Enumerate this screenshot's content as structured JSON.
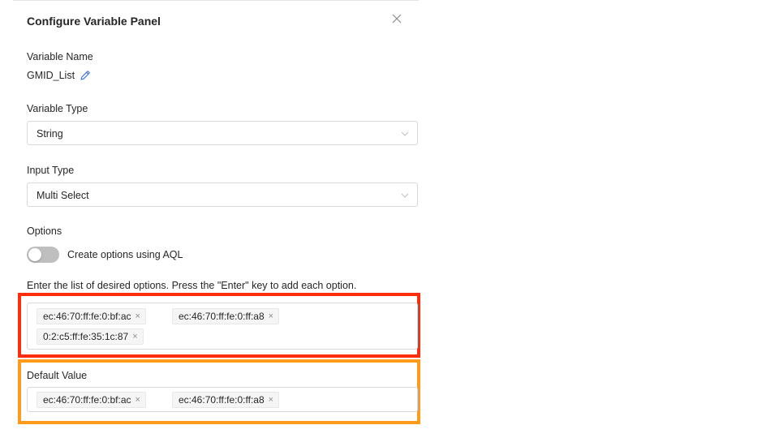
{
  "panel": {
    "title": "Configure Variable Panel",
    "close_icon": "close-icon"
  },
  "variable_name": {
    "label": "Variable Name",
    "value": "GMID_List",
    "edit_icon": "pencil-icon"
  },
  "variable_type": {
    "label": "Variable Type",
    "selected": "String"
  },
  "input_type": {
    "label": "Input Type",
    "selected": "Multi Select"
  },
  "options": {
    "label": "Options",
    "toggle_label": "Create options using AQL",
    "toggle_on": false,
    "hint": "Enter the list of desired options. Press the \"Enter\" key to add each option.",
    "tags": [
      "ec:46:70:ff:fe:0:bf:ac",
      "ec:46:70:ff:fe:0:ff:a8",
      "0:2:c5:ff:fe:35:1c:87"
    ]
  },
  "default_value": {
    "label": "Default Value",
    "tags": [
      "ec:46:70:ff:fe:0:bf:ac",
      "ec:46:70:ff:fe:0:ff:a8"
    ]
  },
  "remove_glyph": "×",
  "colors": {
    "highlight_options": "#ff2d0a",
    "highlight_default": "#ff9a1a",
    "edit_icon": "#3b6fe0"
  }
}
